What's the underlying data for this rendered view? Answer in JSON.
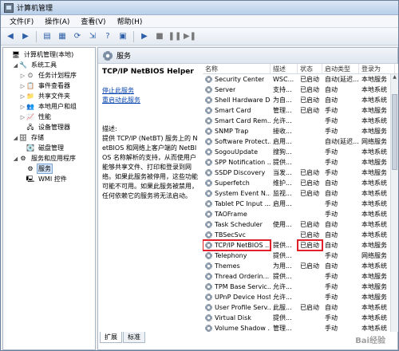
{
  "window": {
    "title": "计算机管理"
  },
  "menu": [
    "文件(F)",
    "操作(A)",
    "查看(V)",
    "帮助(H)"
  ],
  "tree": [
    {
      "indent": 0,
      "expander": "",
      "icon": "computer-icon",
      "glyph": "🖥",
      "label": "计算机管理(本地)"
    },
    {
      "indent": 1,
      "expander": "◢",
      "icon": "tools-icon",
      "glyph": "🔧",
      "label": "系统工具"
    },
    {
      "indent": 2,
      "expander": "▷",
      "icon": "clock-icon",
      "glyph": "⏲",
      "label": "任务计划程序"
    },
    {
      "indent": 2,
      "expander": "▷",
      "icon": "event-viewer-icon",
      "glyph": "📋",
      "label": "事件查看器"
    },
    {
      "indent": 2,
      "expander": "▷",
      "icon": "shared-folder-icon",
      "glyph": "📁",
      "label": "共享文件夹"
    },
    {
      "indent": 2,
      "expander": "▷",
      "icon": "users-icon",
      "glyph": "👥",
      "label": "本地用户和组"
    },
    {
      "indent": 2,
      "expander": "▷",
      "icon": "performance-icon",
      "glyph": "📈",
      "label": "性能"
    },
    {
      "indent": 2,
      "expander": "",
      "icon": "device-manager-icon",
      "glyph": "🖧",
      "label": "设备管理器"
    },
    {
      "indent": 1,
      "expander": "◢",
      "icon": "storage-icon",
      "glyph": "🗄",
      "label": "存储"
    },
    {
      "indent": 2,
      "expander": "",
      "icon": "disk-icon",
      "glyph": "💽",
      "label": "磁盘管理"
    },
    {
      "indent": 1,
      "expander": "◢",
      "icon": "services-apps-icon",
      "glyph": "⚙",
      "label": "服务和应用程序"
    },
    {
      "indent": 2,
      "expander": "",
      "icon": "services-icon",
      "glyph": "⚙",
      "label": "服务",
      "selected": true
    },
    {
      "indent": 2,
      "expander": "",
      "icon": "wmi-icon",
      "glyph": "🖳",
      "label": "WMI 控件"
    }
  ],
  "panel": {
    "header": "服务"
  },
  "details": {
    "service_name": "TCP/IP NetBIOS Helper",
    "stop_link": "停止此服务",
    "restart_link": "重启动此服务",
    "desc_label": "描述:",
    "desc_text": "提供 TCP/IP (NetBT) 服务上的 NetBIOS 和网络上客户端的 NetBIOS 名称解析的支持，从而使用户能够共享文件、打印和登录到网络。如果此服务被停用，这些功能可能不可用。如果此服务被禁用，任何依赖它的服务将无法启动。"
  },
  "columns": [
    "名称",
    "描述",
    "状态",
    "启动类型",
    "登录为"
  ],
  "services": [
    [
      "Security Center",
      "WSC...",
      "已启动",
      "自动(延迟...",
      "本地服务"
    ],
    [
      "Server",
      "支持...",
      "已启动",
      "自动",
      "本地系统"
    ],
    [
      "Shell Hardware De...",
      "为自...",
      "已启动",
      "自动",
      "本地系统"
    ],
    [
      "Smart Card",
      "管理...",
      "已启动",
      "手动",
      "本地服务"
    ],
    [
      "Smart Card Rem...",
      "允许...",
      "",
      "手动",
      "本地系统"
    ],
    [
      "SNMP Trap",
      "接收...",
      "",
      "手动",
      "本地服务"
    ],
    [
      "Software Protect...",
      "启用...",
      "",
      "自动(延迟...",
      "网络服务"
    ],
    [
      "SogouUpdate",
      "搜狗...",
      "",
      "手动",
      "本地系统"
    ],
    [
      "SPP Notification ...",
      "提供...",
      "",
      "手动",
      "本地服务"
    ],
    [
      "SSDP Discovery",
      "当发...",
      "已启动",
      "手动",
      "本地服务"
    ],
    [
      "Superfetch",
      "维护...",
      "已启动",
      "自动",
      "本地系统"
    ],
    [
      "System Event N...",
      "监视...",
      "已启动",
      "自动",
      "本地系统"
    ],
    [
      "Tablet PC Input ...",
      "启用...",
      "",
      "手动",
      "本地系统"
    ],
    [
      "TAOFrame",
      "",
      "",
      "手动",
      "本地系统"
    ],
    [
      "Task Scheduler",
      "使用...",
      "已启动",
      "自动",
      "本地系统"
    ],
    [
      "TBSecSvc",
      "",
      "已启动",
      "自动",
      "本地系统"
    ],
    [
      "TCP/IP NetBIOS ...",
      "提供...",
      "已启动",
      "自动",
      "本地服务"
    ],
    [
      "Telephony",
      "提供...",
      "",
      "手动",
      "网络服务"
    ],
    [
      "Themes",
      "为用...",
      "已启动",
      "自动",
      "本地系统"
    ],
    [
      "Thread Orderin...",
      "提供...",
      "",
      "手动",
      "本地服务"
    ],
    [
      "TPM Base Servic...",
      "允许...",
      "",
      "手动",
      "本地服务"
    ],
    [
      "UPnP Device Host",
      "允许...",
      "",
      "手动",
      "本地服务"
    ],
    [
      "User Profile Serv...",
      "此服...",
      "已启动",
      "自动",
      "本地系统"
    ],
    [
      "Virtual Disk",
      "提供...",
      "",
      "手动",
      "本地系统"
    ],
    [
      "Volume Shadow ...",
      "管理...",
      "",
      "手动",
      "本地系统"
    ]
  ],
  "highlighted_index": 16,
  "tabs": [
    "扩展",
    "标准"
  ],
  "watermark": "Bai经验"
}
